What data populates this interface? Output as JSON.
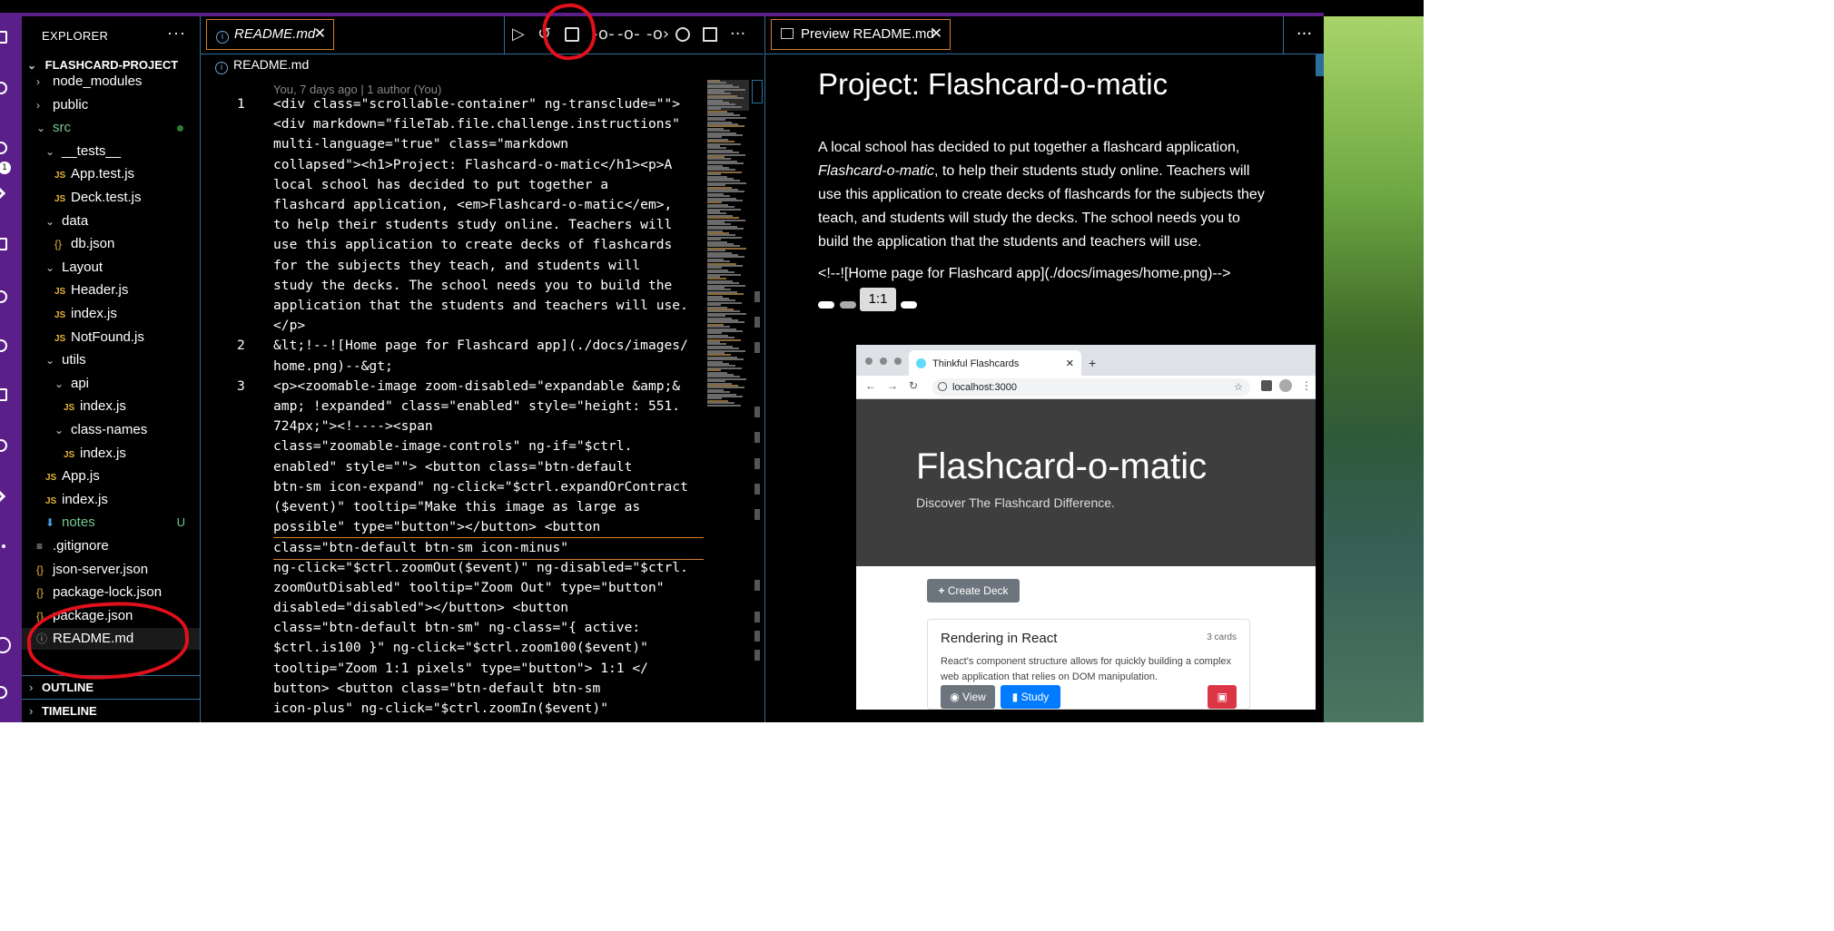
{
  "explorer": {
    "title": "EXPLORER",
    "project": "FLASHCARD-PROJECT",
    "tree": [
      {
        "label": "node_modules",
        "kind": "folder",
        "open": false,
        "depth": 1
      },
      {
        "label": "public",
        "kind": "folder",
        "open": false,
        "depth": 1
      },
      {
        "label": "src",
        "kind": "folder",
        "open": true,
        "depth": 1,
        "color": "#73c991"
      },
      {
        "label": "__tests__",
        "kind": "folder",
        "open": true,
        "depth": 2
      },
      {
        "label": "App.test.js",
        "kind": "js",
        "depth": 3
      },
      {
        "label": "Deck.test.js",
        "kind": "js",
        "depth": 3
      },
      {
        "label": "data",
        "kind": "folder",
        "open": true,
        "depth": 2
      },
      {
        "label": "db.json",
        "kind": "json",
        "depth": 3
      },
      {
        "label": "Layout",
        "kind": "folder",
        "open": true,
        "depth": 2
      },
      {
        "label": "Header.js",
        "kind": "js",
        "depth": 3
      },
      {
        "label": "index.js",
        "kind": "js",
        "depth": 3
      },
      {
        "label": "NotFound.js",
        "kind": "js",
        "depth": 3
      },
      {
        "label": "utils",
        "kind": "folder",
        "open": true,
        "depth": 2
      },
      {
        "label": "api",
        "kind": "folder",
        "open": true,
        "depth": 3
      },
      {
        "label": "index.js",
        "kind": "js",
        "depth": 4
      },
      {
        "label": "class-names",
        "kind": "folder",
        "open": true,
        "depth": 3
      },
      {
        "label": "index.js",
        "kind": "js",
        "depth": 4
      },
      {
        "label": "App.js",
        "kind": "js",
        "depth": 2
      },
      {
        "label": "index.js",
        "kind": "js",
        "depth": 2
      },
      {
        "label": "notes",
        "kind": "notes",
        "depth": 2,
        "badge": "U",
        "color": "#73c991"
      },
      {
        "label": ".gitignore",
        "kind": "git",
        "depth": 1
      },
      {
        "label": "json-server.json",
        "kind": "json",
        "depth": 1
      },
      {
        "label": "package-lock.json",
        "kind": "json",
        "depth": 1
      },
      {
        "label": "package.json",
        "kind": "json",
        "depth": 1
      },
      {
        "label": "README.md",
        "kind": "info",
        "depth": 1
      }
    ],
    "outline": "OUTLINE",
    "timeline": "TIMELINE",
    "src_status_dot": "#2e7d32",
    "untracked_badge": "U"
  },
  "editor": {
    "tab_label": "README.md",
    "breadcrumb": "README.md",
    "blame": "You, 7 days ago | 1 author (You)",
    "line_numbers": [
      "1",
      "2",
      "3"
    ],
    "toolbar_icons": [
      "run-icon",
      "history-icon",
      "open-preview-side-icon",
      "git-commit-icon",
      "git-compare-icon",
      "git-next-icon",
      "git-blame-icon",
      "split-editor-icon",
      "more-actions-icon"
    ],
    "code": [
      "<div class=\"scrollable-container\" ng-transclude=\"\">",
      "<div markdown=\"fileTab.file.challenge.instructions\"",
      "multi-language=\"true\" class=\"markdown",
      "collapsed\"><h1>Project: Flashcard-o-matic</h1><p>A",
      "local school has decided to put together a",
      "flashcard application, <em>Flashcard-o-matic</em>,",
      "to help their students study online. Teachers will",
      "use this application to create decks of flashcards",
      "for the subjects they teach, and students will",
      "study the decks. The school needs you to build the",
      "application that the students and teachers will use.",
      "</p>",
      "&lt;!--![Home page for Flashcard app](./docs/images/",
      "home.png)--&gt;",
      "<p><zoomable-image zoom-disabled=\"expandable &amp;&",
      "amp; !expanded\" class=\"enabled\" style=\"height: 551.",
      "724px;\"><!----><span",
      "class=\"zoomable-image-controls\" ng-if=\"$ctrl.",
      "enabled\" style=\"\"> <button class=\"btn-default",
      "btn-sm icon-expand\" ng-click=\"$ctrl.expandOrContract",
      "($event)\" tooltip=\"Make this image as large as",
      "possible\" type=\"button\"></button> <button",
      "class=\"btn-default btn-sm icon-minus\"",
      "ng-click=\"$ctrl.zoomOut($event)\" ng-disabled=\"$ctrl.",
      "zoomOutDisabled\" tooltip=\"Zoom Out\" type=\"button\"",
      "disabled=\"disabled\"></button> <button",
      "class=\"btn-default btn-sm\" ng-class=\"{ active:",
      "$ctrl.is100 }\" ng-click=\"$ctrl.zoom100($event)\"",
      "tooltip=\"Zoom 1:1 pixels\" type=\"button\"> 1:1 </",
      "button> <button class=\"btn-default btn-sm",
      "icon-plus\" ng-click=\"$ctrl.zoomIn($event)\""
    ]
  },
  "preview": {
    "tab_label": "Preview README.md",
    "heading": "Project: Flashcard-o-matic",
    "paragraph_before": "A local school has decided to put together a flashcard application,",
    "paragraph_em": "Flashcard-o-matic",
    "paragraph_after": ", to help their students study online. Teachers will use this application to create decks of flashcards for the subjects they teach, and students will study the decks. The school needs you to build the application that the students and teachers will use.",
    "comment_line": "<!--![Home page for Flashcard app](./docs/images/home.png)-->",
    "zoom_label": "1:1",
    "screenshot": {
      "tab_title": "Thinkful Flashcards",
      "url": "localhost:3000",
      "app_title": "Flashcard-o-matic",
      "app_subtitle": "Discover The Flashcard Difference.",
      "create_deck": "Create Deck",
      "deck_name": "Rendering in React",
      "deck_count": "3 cards",
      "deck_desc": "React's component structure allows for quickly building a complex web application that relies on DOM manipulation.",
      "view_button": "View",
      "study_button": "Study"
    }
  },
  "colors": {
    "activity_bar": "#5b1f8a",
    "accent_border": "#2a6f99",
    "tab_border": "#d08030",
    "annotation_red": "#e0101c"
  }
}
